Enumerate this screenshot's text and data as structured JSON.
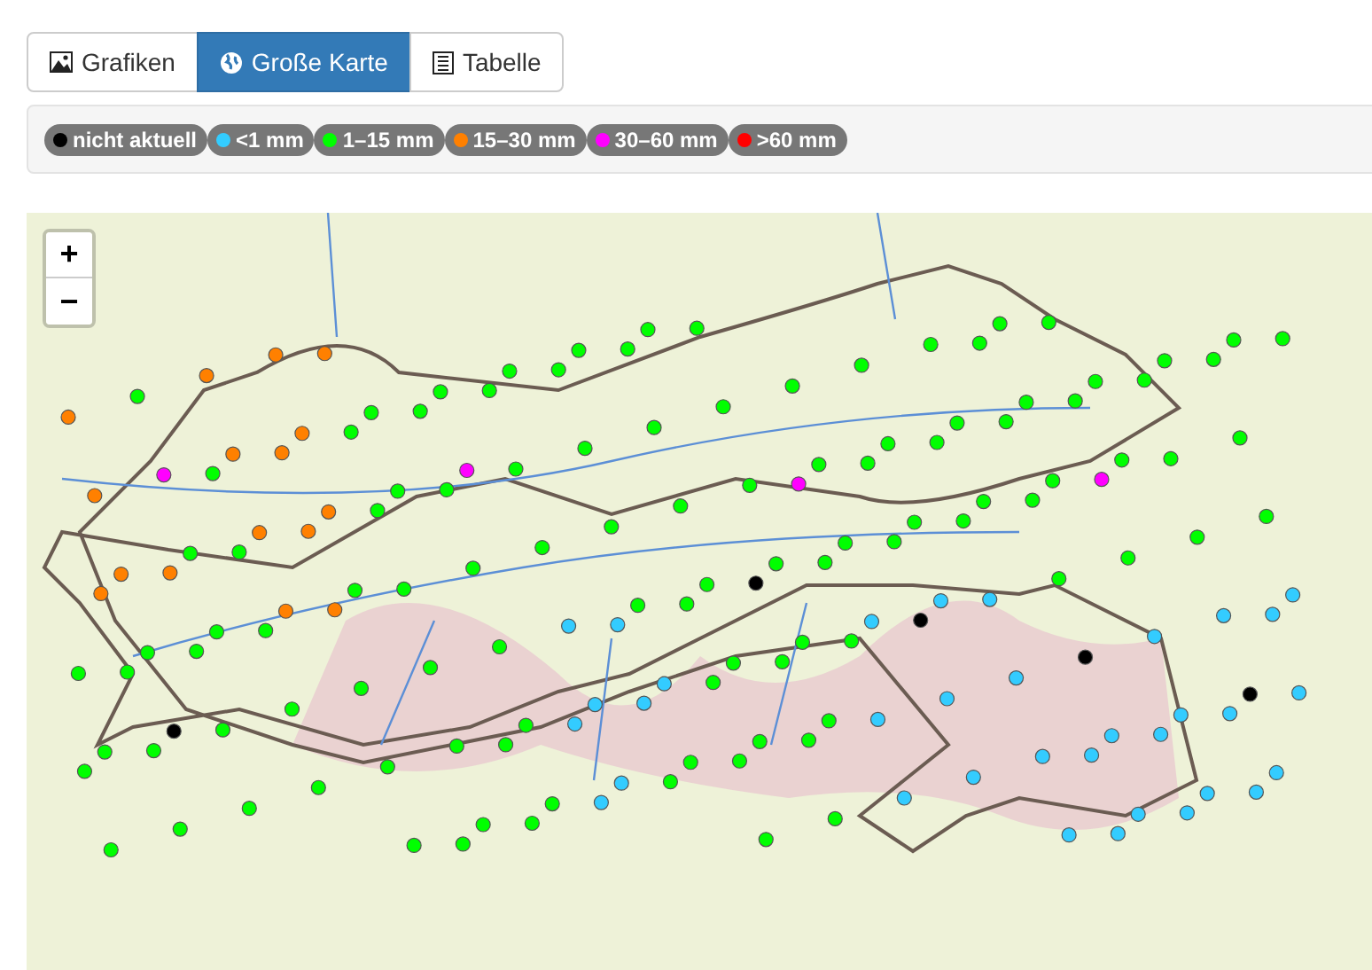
{
  "tabs": [
    {
      "label": "Grafiken",
      "kind": "picture",
      "selected": false
    },
    {
      "label": "Große Karte",
      "kind": "globe",
      "selected": true
    },
    {
      "label": "Tabelle",
      "kind": "list",
      "selected": false
    }
  ],
  "legend": [
    {
      "label": "nicht aktuell",
      "color": "#000000"
    },
    {
      "label": "<1 mm",
      "color": "#33ccff"
    },
    {
      "label": "1–15 mm",
      "color": "#00ff00"
    },
    {
      "label": "15–30 mm",
      "color": "#ff8000"
    },
    {
      "label": "30–60 mm",
      "color": "#ff00ff"
    },
    {
      "label": ">60 mm",
      "color": "#ff0000"
    }
  ],
  "map": {
    "zoom_in": "+",
    "zoom_out": "−"
  }
}
